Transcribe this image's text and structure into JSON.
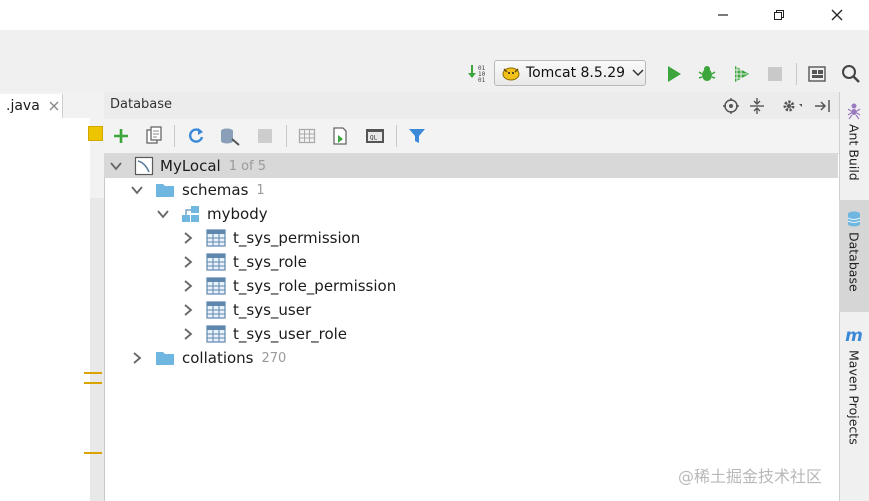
{
  "editor": {
    "tab_label": ".java"
  },
  "toolbar": {
    "run_config_label": "Tomcat 8.5.29"
  },
  "database_panel": {
    "title": "Database",
    "tree": {
      "root": {
        "label": "MyLocal",
        "count": "1 of 5"
      },
      "schemas": {
        "label": "schemas",
        "count": "1"
      },
      "schema": {
        "label": "mybody"
      },
      "tables": [
        "t_sys_permission",
        "t_sys_role",
        "t_sys_role_permission",
        "t_sys_user",
        "t_sys_user_role"
      ],
      "collations": {
        "label": "collations",
        "count": "270"
      }
    }
  },
  "right_tabs": {
    "ant_build": "Ant Build",
    "database": "Database",
    "maven": "Maven Projects"
  },
  "watermark": "@稀土掘金技术社区",
  "colors": {
    "accent_green": "#3ca63c",
    "folder_blue": "#6fb6e0",
    "selection_gray": "#d8d8d8",
    "filter_blue": "#3b8ad8"
  }
}
